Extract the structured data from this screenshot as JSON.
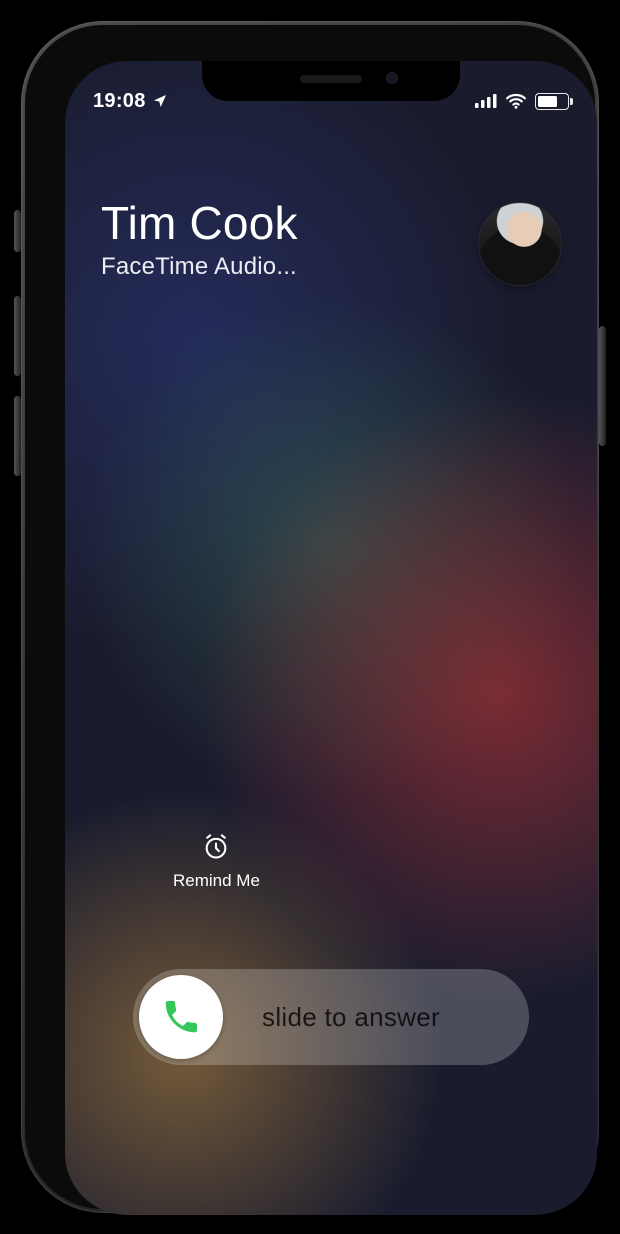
{
  "status_bar": {
    "time": "19:08",
    "location_icon": "location-arrow-icon",
    "signal_icon": "cellular-signal-icon",
    "wifi_icon": "wifi-icon",
    "battery_icon": "battery-icon"
  },
  "caller": {
    "name": "Tim Cook",
    "subtitle": "FaceTime Audio...",
    "avatar_icon": "caller-avatar"
  },
  "actions": {
    "remind_me": {
      "icon": "alarm-clock-icon",
      "label": "Remind Me"
    }
  },
  "slider": {
    "knob_icon": "phone-icon",
    "label": "slide to answer"
  },
  "colors": {
    "accent_green": "#34C759"
  }
}
